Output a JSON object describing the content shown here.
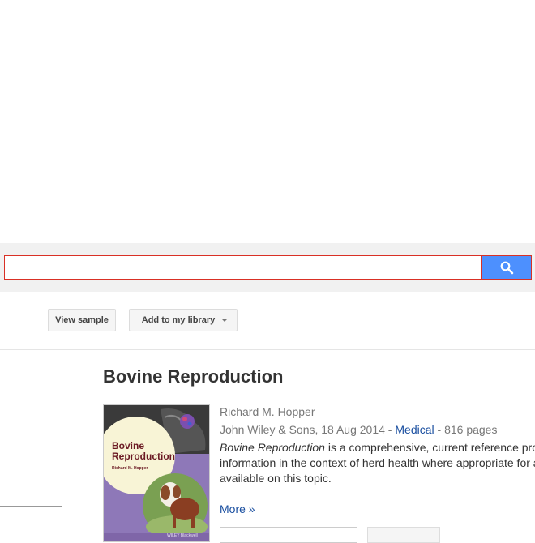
{
  "search": {
    "placeholder": "",
    "value": "",
    "button_icon": "search-icon"
  },
  "toolbar": {
    "view_sample": "View sample",
    "add_library": "Add to my library"
  },
  "book": {
    "title": "Bovine Reproduction",
    "author": "Richard M. Hopper",
    "publisher_date": "John Wiley & Sons, 18 Aug 2014",
    "sep1": " - ",
    "category": "Medical",
    "pages": " - 816 pages",
    "desc_title": "Bovine Reproduction",
    "desc_line1": " is a comprehensive, current reference providin",
    "desc_line2": "information in the context of herd health where appropriate for a trul",
    "desc_line3": "available on this topic.",
    "more": "More »",
    "cover": {
      "title_line1": "Bovine",
      "title_line2": "Reproduction",
      "author": "Richard M. Hopper",
      "publisher": "WILEY Blackwell"
    }
  },
  "colors": {
    "accent": "#4d90fe",
    "link": "#1a4fa0",
    "focus_border": "#d93025"
  }
}
